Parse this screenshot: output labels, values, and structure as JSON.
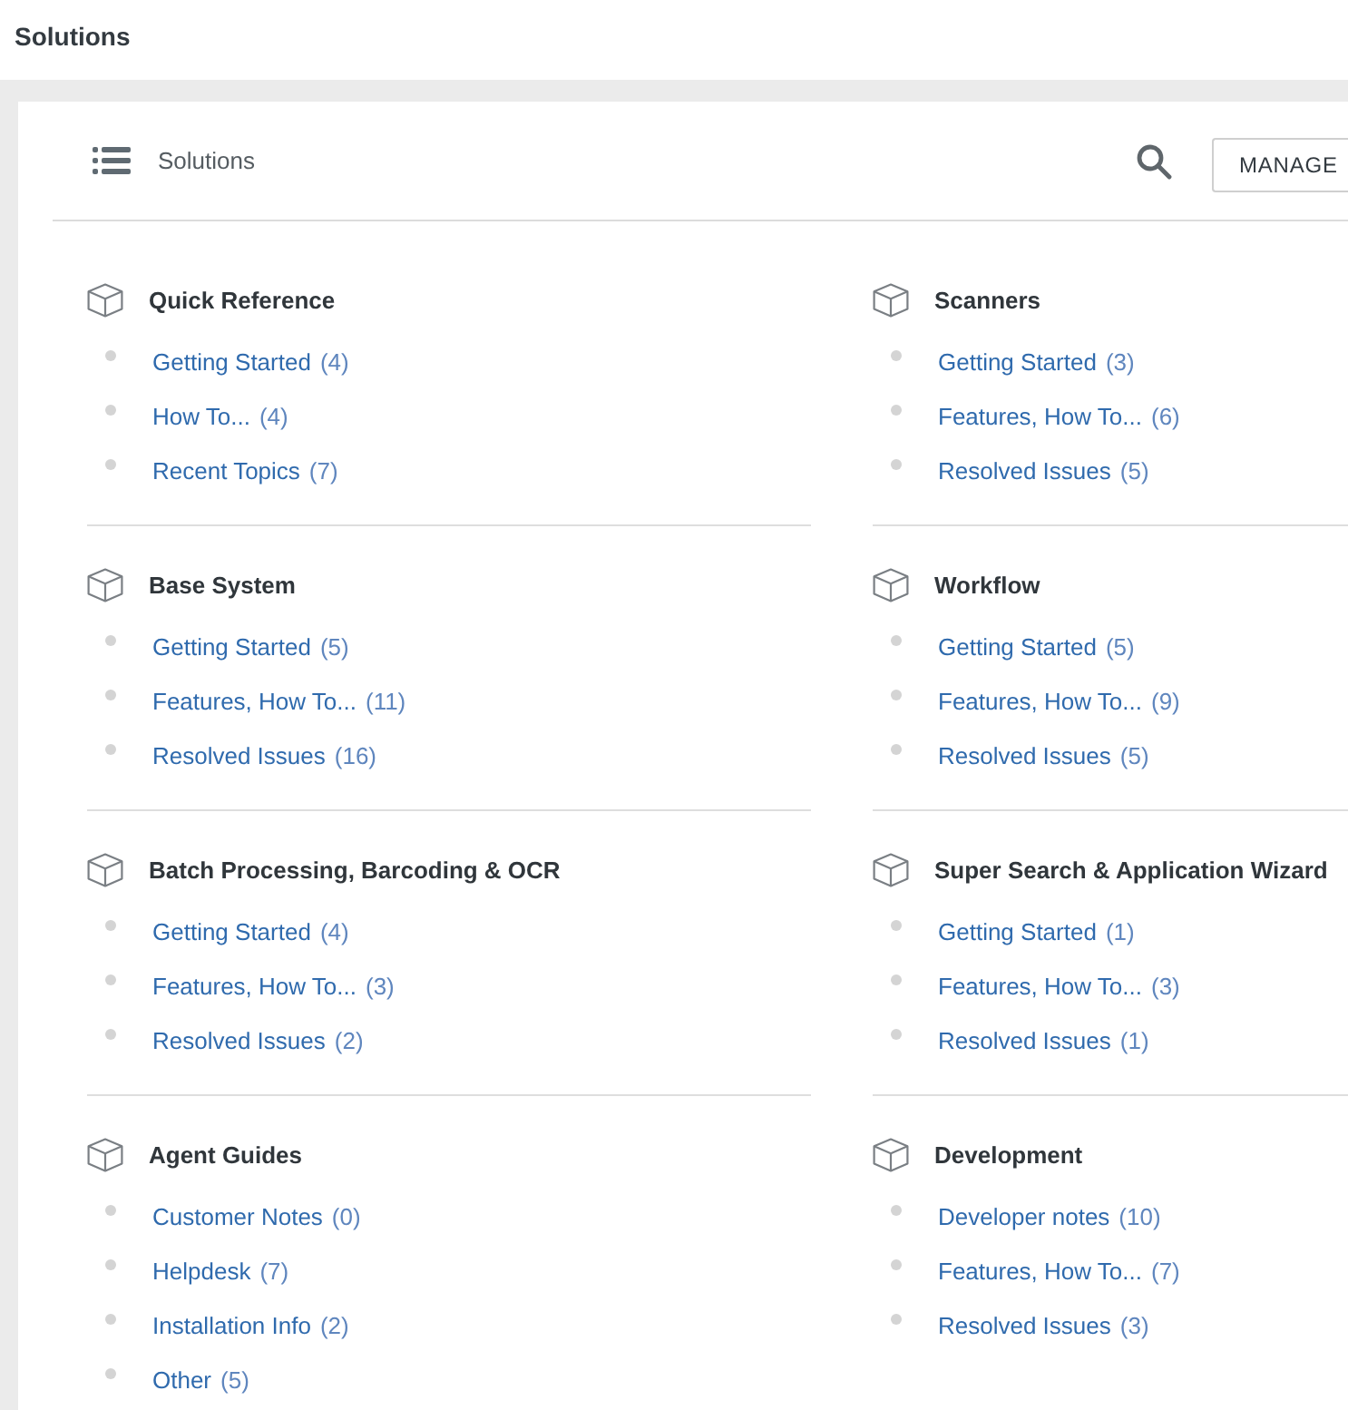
{
  "top_bar": {
    "title": "Solutions"
  },
  "header": {
    "title": "Solutions",
    "manage_button": "MANAGE"
  },
  "categories": [
    {
      "title": "Quick Reference",
      "items": [
        {
          "label": "Getting Started",
          "count": "(4)"
        },
        {
          "label": "How To...",
          "count": "(4)"
        },
        {
          "label": "Recent Topics",
          "count": "(7)"
        }
      ]
    },
    {
      "title": "Scanners",
      "items": [
        {
          "label": "Getting Started",
          "count": "(3)"
        },
        {
          "label": "Features, How To...",
          "count": "(6)"
        },
        {
          "label": "Resolved Issues",
          "count": "(5)"
        }
      ]
    },
    {
      "title": "Base System",
      "items": [
        {
          "label": "Getting Started",
          "count": "(5)"
        },
        {
          "label": "Features, How To...",
          "count": "(11)"
        },
        {
          "label": "Resolved Issues",
          "count": "(16)"
        }
      ]
    },
    {
      "title": "Workflow",
      "items": [
        {
          "label": "Getting Started",
          "count": "(5)"
        },
        {
          "label": "Features, How To...",
          "count": "(9)"
        },
        {
          "label": "Resolved Issues",
          "count": "(5)"
        }
      ]
    },
    {
      "title": "Batch Processing, Barcoding & OCR",
      "items": [
        {
          "label": "Getting Started",
          "count": "(4)"
        },
        {
          "label": "Features, How To...",
          "count": "(3)"
        },
        {
          "label": "Resolved Issues",
          "count": "(2)"
        }
      ]
    },
    {
      "title": "Super Search & Application Wizard",
      "items": [
        {
          "label": "Getting Started",
          "count": "(1)"
        },
        {
          "label": "Features, How To...",
          "count": "(3)"
        },
        {
          "label": "Resolved Issues",
          "count": "(1)"
        }
      ]
    },
    {
      "title": "Agent Guides",
      "items": [
        {
          "label": "Customer Notes",
          "count": "(0)"
        },
        {
          "label": "Helpdesk",
          "count": "(7)"
        },
        {
          "label": "Installation Info",
          "count": "(2)"
        },
        {
          "label": "Other",
          "count": "(5)"
        }
      ]
    },
    {
      "title": "Development",
      "items": [
        {
          "label": "Developer notes",
          "count": "(10)"
        },
        {
          "label": "Features, How To...",
          "count": "(7)"
        },
        {
          "label": "Resolved Issues",
          "count": "(3)"
        }
      ]
    }
  ]
}
